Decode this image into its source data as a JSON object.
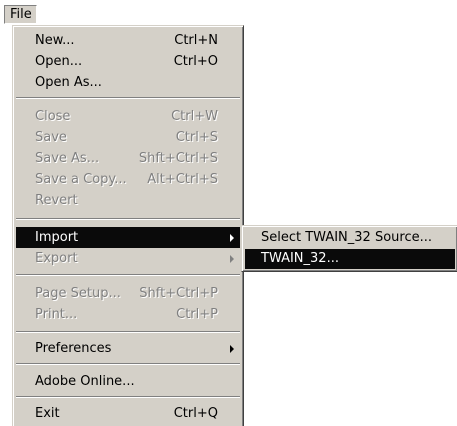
{
  "menubar": {
    "file_label": "File"
  },
  "file_menu": {
    "new": {
      "label": "New...",
      "shortcut": "Ctrl+N"
    },
    "open": {
      "label": "Open...",
      "shortcut": "Ctrl+O"
    },
    "open_as": {
      "label": "Open As..."
    },
    "close": {
      "label": "Close",
      "shortcut": "Ctrl+W"
    },
    "save": {
      "label": "Save",
      "shortcut": "Ctrl+S"
    },
    "save_as": {
      "label": "Save As...",
      "shortcut": "Shft+Ctrl+S"
    },
    "save_copy": {
      "label": "Save a Copy...",
      "shortcut": "Alt+Ctrl+S"
    },
    "revert": {
      "label": "Revert"
    },
    "import": {
      "label": "Import"
    },
    "export": {
      "label": "Export"
    },
    "page_setup": {
      "label": "Page Setup...",
      "shortcut": "Shft+Ctrl+P"
    },
    "print": {
      "label": "Print...",
      "shortcut": "Ctrl+P"
    },
    "preferences": {
      "label": "Preferences"
    },
    "adobe_online": {
      "label": "Adobe Online..."
    },
    "exit": {
      "label": "Exit",
      "shortcut": "Ctrl+Q"
    }
  },
  "import_submenu": {
    "select_source": {
      "label": "Select TWAIN_32 Source..."
    },
    "twain": {
      "label": "TWAIN_32..."
    }
  },
  "colors": {
    "menu_bg": "#d4d0c8",
    "highlight": "#0a0a0a",
    "disabled_text": "#808080"
  }
}
